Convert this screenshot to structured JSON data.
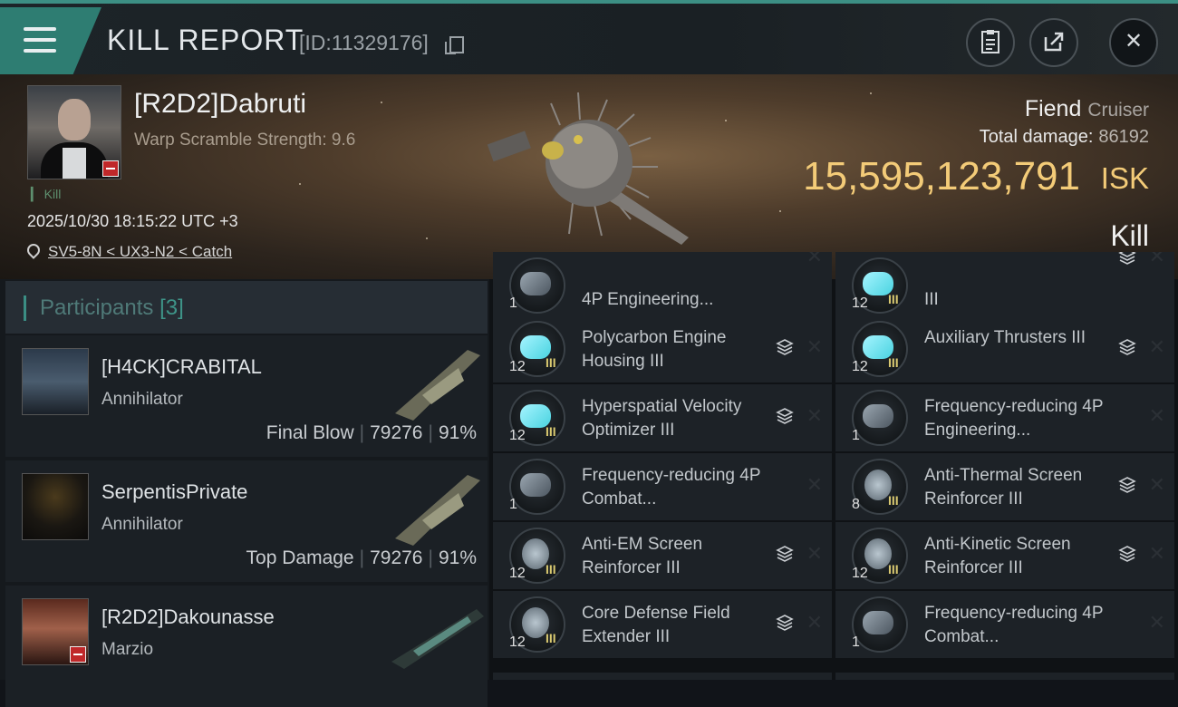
{
  "header": {
    "title": "KILL REPORT",
    "report_id": "[ID:11329176]",
    "close_glyph": "✕"
  },
  "victim": {
    "name": "[R2D2]Dabruti",
    "warp_scramble": "Warp Scramble Strength: 9.6",
    "kill_tag": "▎ Kill",
    "time": "2025/10/30 18:15:22 UTC +3",
    "location": "SV5-8N < UX3-N2 < Catch",
    "ship_name": "Fiend",
    "ship_class": "Cruiser",
    "total_damage_label": "Total damage:",
    "total_damage": "86192",
    "isk_value": "15,595,123,791",
    "isk_unit": "ISK",
    "result": "Kill"
  },
  "participants": {
    "label": "Participants",
    "count": "[3]",
    "rows": [
      {
        "name": "[H4CK]CRABITAL",
        "ship": "Annihilator",
        "role": "Final Blow",
        "damage": "79276",
        "percent": "91%"
      },
      {
        "name": "SerpentisPrivate",
        "ship": "Annihilator",
        "role": "Top Damage",
        "damage": "79276",
        "percent": "91%"
      },
      {
        "name": "[R2D2]Dakounasse",
        "ship": "Marzio",
        "role": "",
        "damage": "",
        "percent": ""
      }
    ]
  },
  "modules": {
    "tier": "III",
    "left": [
      {
        "qty": "1",
        "name": "4P Engineering...",
        "tier": ""
      },
      {
        "qty": "12",
        "name": "Polycarbon Engine Housing III",
        "tier": "III"
      },
      {
        "qty": "12",
        "name": "Hyperspatial Velocity Optimizer III",
        "tier": "III"
      },
      {
        "qty": "1",
        "name": "Frequency-reducing 4P Combat...",
        "tier": ""
      },
      {
        "qty": "12",
        "name": "Anti-EM Screen Reinforcer III",
        "tier": "III"
      },
      {
        "qty": "12",
        "name": "Core Defense Field Extender III",
        "tier": "III"
      }
    ],
    "right": [
      {
        "qty": "12",
        "name": "III",
        "tier": "III"
      },
      {
        "qty": "12",
        "name": "Auxiliary Thrusters III",
        "tier": "III"
      },
      {
        "qty": "1",
        "name": "Frequency-reducing 4P Engineering...",
        "tier": ""
      },
      {
        "qty": "8",
        "name": "Anti-Thermal Screen Reinforcer III",
        "tier": "III"
      },
      {
        "qty": "12",
        "name": "Anti-Kinetic Screen Reinforcer III",
        "tier": "III"
      },
      {
        "qty": "1",
        "name": "Frequency-reducing 4P Combat...",
        "tier": ""
      }
    ]
  },
  "colors": {
    "accent": "#2e7d72",
    "isk": "#f3cb78",
    "panel": "#1d2227"
  }
}
